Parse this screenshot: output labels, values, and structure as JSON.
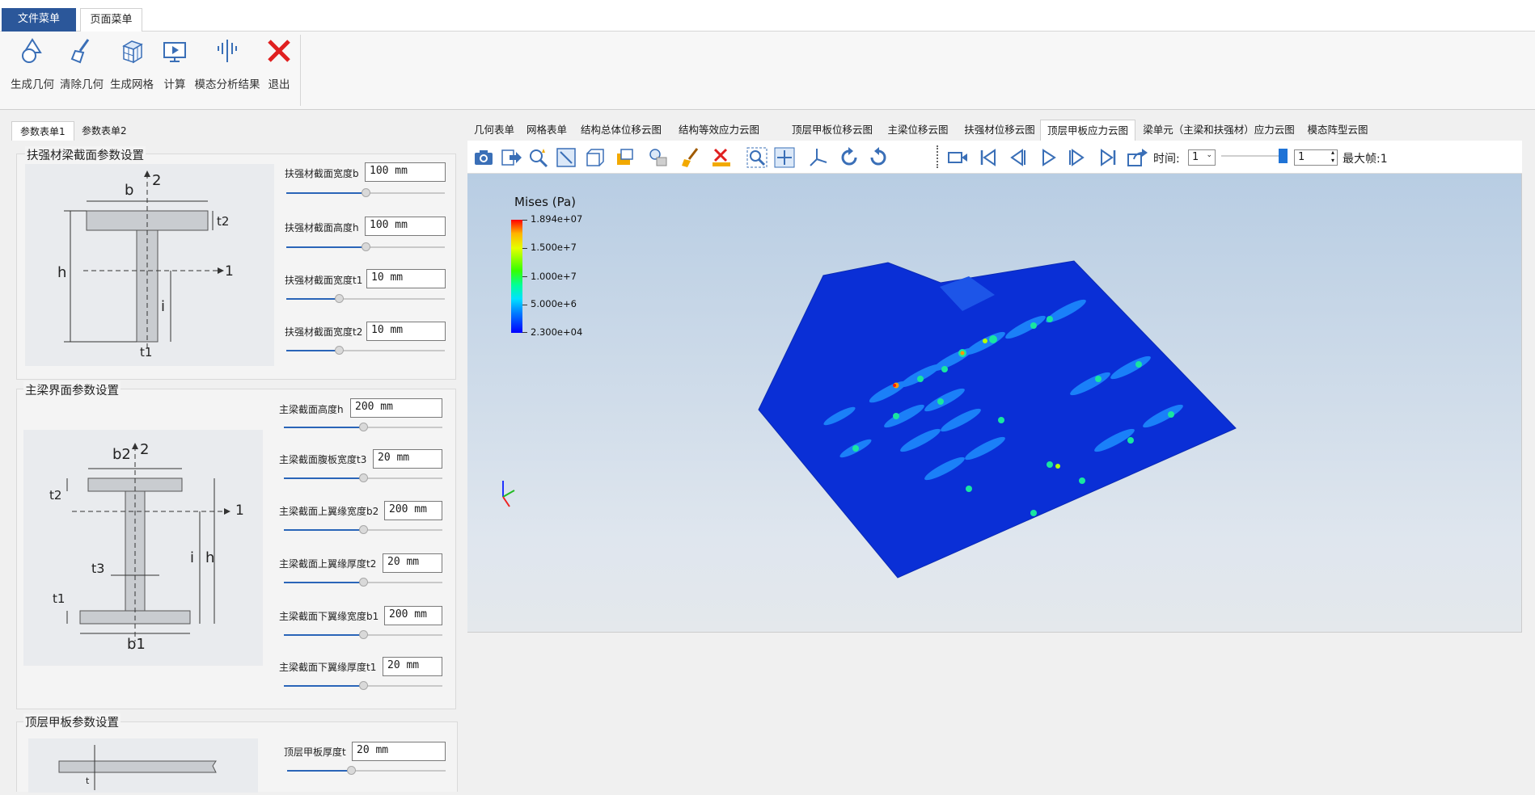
{
  "menu": {
    "file_tab": "文件菜单",
    "page_tab": "页面菜单"
  },
  "ribbon": {
    "buttons": [
      {
        "label": "生成几何",
        "icon": "geometry-icon"
      },
      {
        "label": "清除几何",
        "icon": "broom-icon"
      },
      {
        "label": "生成网格",
        "icon": "mesh-cube-icon"
      },
      {
        "label": "计算",
        "icon": "compute-monitor-icon"
      },
      {
        "label": "模态分析结果",
        "icon": "modal-result-icon"
      },
      {
        "label": "退出",
        "icon": "close-red-x-icon"
      }
    ]
  },
  "left_tabs": [
    "参数表单1",
    "参数表单2"
  ],
  "groups": {
    "stiffener": {
      "title": "扶强材梁截面参数设置",
      "params": [
        {
          "label": "扶强材截面宽度b",
          "value": "100 mm"
        },
        {
          "label": "扶强材截面高度h",
          "value": "100 mm"
        },
        {
          "label": "扶强材截面宽度t1",
          "value": "10 mm"
        },
        {
          "label": "扶强材截面宽度t2",
          "value": "10 mm"
        }
      ],
      "diagram": {
        "b": "b",
        "h": "h",
        "t1": "t1",
        "t2": "t2",
        "i": "i",
        "axis1": "1",
        "axis2": "2"
      }
    },
    "main_beam": {
      "title": "主梁界面参数设置",
      "params": [
        {
          "label": "主梁截面高度h",
          "value": "200 mm"
        },
        {
          "label": "主梁截面腹板宽度t3",
          "value": "20 mm"
        },
        {
          "label": "主梁截面上翼缘宽度b2",
          "value": "200 mm"
        },
        {
          "label": "主梁截面上翼缘厚度t2",
          "value": "20 mm"
        },
        {
          "label": "主梁截面下翼缘宽度b1",
          "value": "200 mm"
        },
        {
          "label": "主梁截面下翼缘厚度t1",
          "value": "20 mm"
        }
      ],
      "diagram": {
        "b1": "b1",
        "b2": "b2",
        "h": "h",
        "t1": "t1",
        "t2": "t2",
        "t3": "t3",
        "i": "i",
        "axis1": "1",
        "axis2": "2"
      }
    },
    "deck": {
      "title": "顶层甲板参数设置",
      "params": [
        {
          "label": "顶层甲板厚度t",
          "value": "20 mm"
        }
      ],
      "diagram": {
        "t": "t"
      }
    }
  },
  "slider_levels": [
    0.5,
    0.5,
    0.33,
    0.33,
    0.5,
    0.5,
    0.5,
    0.5,
    0.5,
    0.5,
    0.4
  ],
  "result_tabs": [
    "几何表单",
    "网格表单",
    "结构总体位移云图",
    "结构等效应力云图",
    "顶层甲板位移云图",
    "主梁位移云图",
    "扶强材位移云图",
    "顶层甲板应力云图",
    "梁单元（主梁和扶强材）应力云图",
    "模态阵型云图"
  ],
  "active_result_tab": "顶层甲板应力云图",
  "toolbar": {
    "time_label": "时间:",
    "time_value": "1",
    "frame_value": "1",
    "max_frame_label": "最大帧:1",
    "icons": [
      "camera-icon",
      "export-icon",
      "pick-zoom-icon",
      "fit-view-icon",
      "cube-view-icon",
      "display-mode-icon",
      "light-icon",
      "brush-icon",
      "clip-icon",
      "zoom-box-icon",
      "pan-icon",
      "axes-icon",
      "rotate-cw-icon",
      "rotate-ccw-icon",
      "record-icon",
      "first-frame-icon",
      "prev-frame-icon",
      "play-icon",
      "next-frame-icon",
      "last-frame-icon",
      "share-icon"
    ]
  },
  "legend": {
    "title": "Mises (Pa)",
    "labels": [
      "1.894e+07",
      "1.500e+7",
      "1.000e+7",
      "5.000e+6",
      "2.300e+04"
    ]
  },
  "colors": {
    "accent": "#2b579a",
    "exit_red": "#e02020",
    "plate_blue": "#0a2fd6"
  }
}
